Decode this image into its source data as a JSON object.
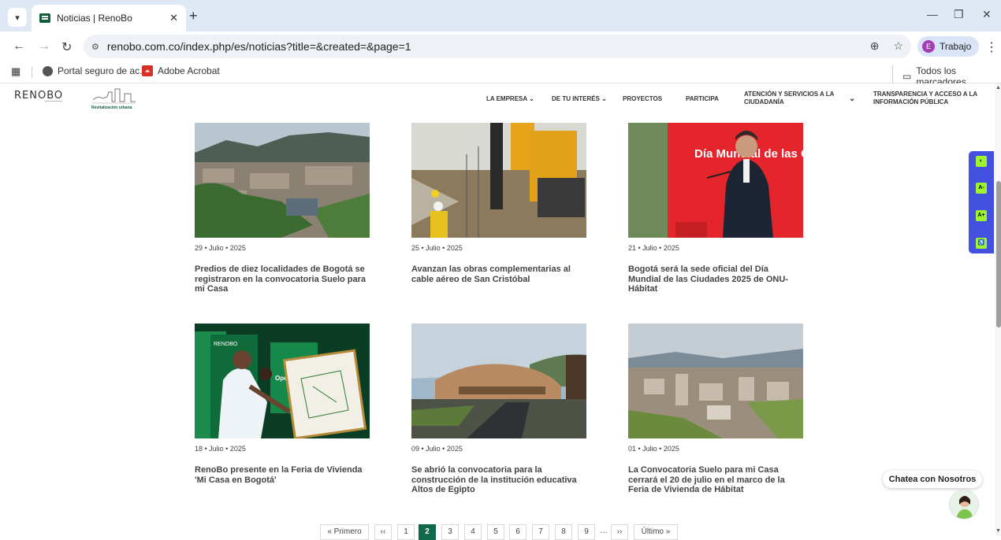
{
  "browser": {
    "tab_title": "Noticias | RenoBo",
    "url": "renobo.com.co/index.php/es/noticias?title=&created=&page=1",
    "profile_name": "Trabajo",
    "profile_initial": "E",
    "bookmarks": [
      "Portal seguro de ac...",
      "Adobe Acrobat"
    ],
    "all_bookmarks": "Todos los marcadores"
  },
  "site": {
    "logo": "RENOBO",
    "brand_sub": "Revitalización urbana",
    "nav": {
      "empresa": "LA EMPRESA",
      "interes": "DE TU INTERÉS",
      "proyectos": "PROYECTOS",
      "participa": "PARTICIPA",
      "atencion": "ATENCIÓN Y SERVICIOS A LA CIUDADANÍA",
      "transparencia": "TRANSPARENCIA Y ACCESO A LA INFORMACIÓN PÚBLICA"
    }
  },
  "news": [
    {
      "date": "29 • Julio • 2025",
      "title": "Predios de diez localidades de Bogotá se registraron en la convocatoria Suelo para mi Casa"
    },
    {
      "date": "25 • Julio • 2025",
      "title": "Avanzan las obras complementarias al cable aéreo de San Cristóbal"
    },
    {
      "date": "21 • Julio • 2025",
      "title": "Bogotá será la sede oficial del Día Mundial de las Ciudades 2025 de ONU-Hábitat"
    },
    {
      "date": "18 • Julio • 2025",
      "title": "RenoBo presente en la Feria de Vivienda 'Mi Casa en Bogotá'"
    },
    {
      "date": "09 • Julio • 2025",
      "title": "Se abrió la convocatoria para la construcción de la institución educativa Altos de Egipto"
    },
    {
      "date": "01 • Julio • 2025",
      "title": "La Convocatoria Suelo para mi Casa cerrará el 20 de julio en el marco de la Feria de Vivienda de Hábitat"
    }
  ],
  "photo_text": {
    "event_sign": "Día Mundial de las Ciudades",
    "fair_banner": "RENOBO",
    "fair_board": "Operación urbana"
  },
  "accessibility": [
    "A-",
    "A+"
  ],
  "chat": {
    "label": "Chatea con Nosotros"
  },
  "pagination": {
    "first": "« Primero",
    "prev": "‹‹",
    "pages": [
      "1",
      "2",
      "3",
      "4",
      "5",
      "6",
      "7",
      "8",
      "9"
    ],
    "current": "2",
    "ellipsis": "…",
    "next": "››",
    "last": "Último »"
  }
}
